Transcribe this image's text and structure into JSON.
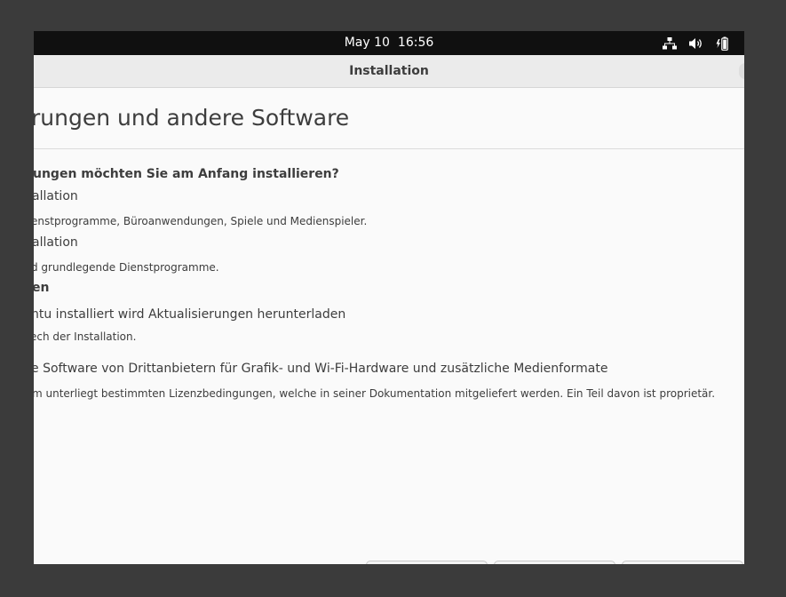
{
  "topbar": {
    "date": "May 10",
    "time": "16:56",
    "icons": [
      "network-wired-icon",
      "volume-icon",
      "battery-icon"
    ]
  },
  "window": {
    "title": "Installation"
  },
  "page": {
    "title": "rungen und andere Software",
    "question": "ungen möchten Sie am Anfang installieren?",
    "option_normal_label": "allation",
    "option_normal_desc": "enstprogramme, Büroanwendungen, Spiele und Medienspieler.",
    "option_minimal_label": "allation",
    "option_minimal_desc": "d grundlegende Dienstprogramme.",
    "section_other": "en",
    "updates_label": "ntu installiert wird Aktualisierungen herunterladen",
    "updates_desc": "ech der Installation.",
    "thirdparty_label": "e Software von Drittanbietern für Grafik- und Wi-Fi-Hardware und zusätzliche Medienformate",
    "thirdparty_desc": "m unterliegt bestimmten Lizenzbedingungen, welche in seiner Dokumentation mitgeliefert werden. Ein Teil davon ist proprietär."
  },
  "colors": {
    "topbar": "#101010",
    "titlebar": "#ebebeb",
    "content_bg": "#fafafa",
    "text": "#3d3d3d",
    "outer_bg": "#3b3b3b"
  }
}
